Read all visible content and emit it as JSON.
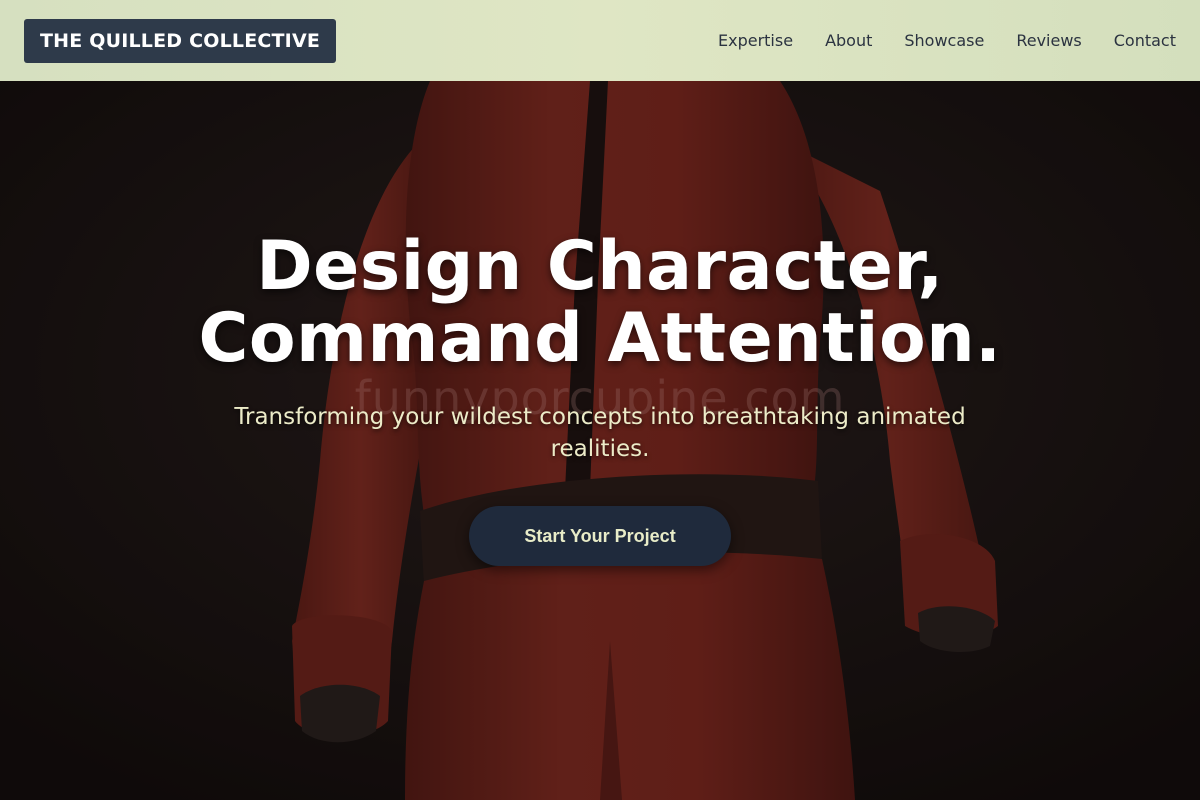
{
  "header": {
    "logo_text": "THE QUILLED COLLECTIVE",
    "nav": [
      {
        "label": "Expertise"
      },
      {
        "label": "About"
      },
      {
        "label": "Showcase"
      },
      {
        "label": "Reviews"
      },
      {
        "label": "Contact"
      }
    ]
  },
  "hero": {
    "title_line1": "Design Character,",
    "title_line2": "Command Attention.",
    "subtitle": "Transforming your wildest concepts into breathtaking animated realities.",
    "cta_label": "Start Your Project",
    "watermark": "funnyporcupine.com"
  },
  "colors": {
    "header_bg": "#dbe3c2",
    "logo_bg": "#2e3a4a",
    "cta_bg": "#1f2a3c",
    "suit": "#8a2a20"
  }
}
